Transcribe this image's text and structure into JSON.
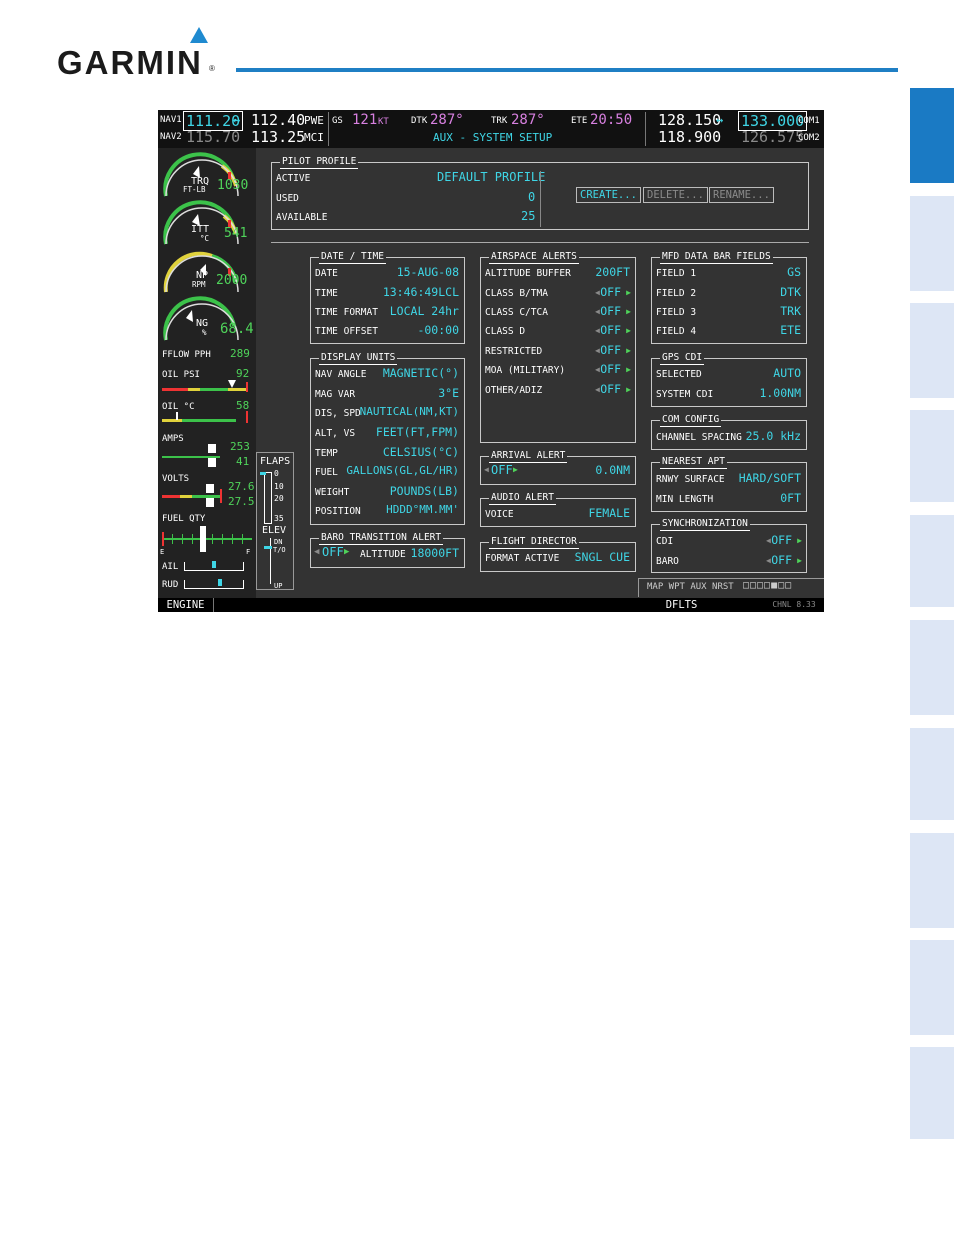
{
  "page": {
    "brand": "GARMIN",
    "registered": "®"
  },
  "header": {
    "nav1_label": "NAV1",
    "nav1_active": "111.20",
    "nav1_arrow": "↔",
    "nav1_standby": "112.40",
    "nav1_id": "PWE",
    "nav2_label": "NAV2",
    "nav2_active": "115.70",
    "nav2_standby": "113.25",
    "nav2_id": "MCI",
    "gs_label": "GS",
    "gs_value": "121",
    "gs_unit": "KT",
    "dtk_label": "DTK",
    "dtk_value": "287°",
    "trk_label": "TRK",
    "trk_value": "287°",
    "ete_label": "ETE",
    "ete_value": "20:50",
    "page_title": "AUX - SYSTEM SETUP",
    "com1_active": "128.150",
    "com1_arrow": "↔",
    "com1_standby": "133.000",
    "com1_label": "COM1",
    "com2_active": "118.900",
    "com2_standby": "126.575",
    "com2_label": "COM2"
  },
  "eis": {
    "trq_label": "TRQ",
    "trq_unit": "FT-LB",
    "trq_value": "1030",
    "itt_label": "ITT",
    "itt_unit": "°C",
    "itt_value": "541",
    "np_label": "NP",
    "np_unit": "RPM",
    "np_value": "2000",
    "ng_label": "NG",
    "ng_unit": "%",
    "ng_value": "68.4",
    "fflow_label": "FFLOW PPH",
    "fflow_value": "289",
    "oilpsi_label": "OIL PSI",
    "oilpsi_value": "92",
    "oilc_label": "OIL °C",
    "oilc_value": "58",
    "amps_label": "AMPS",
    "amps_value1": "253",
    "amps_value2": "41",
    "volts_label": "VOLTS",
    "volts_value1": "27.6",
    "volts_value2": "27.5",
    "fuelqty_label": "FUEL QTY",
    "fuel_e": "E",
    "fuel_f": "F",
    "ail_label": "AIL",
    "rud_label": "RUD",
    "flaps_label": "FLAPS",
    "flaps_ticks": [
      "0",
      "10",
      "20",
      "35"
    ],
    "elev_label": "ELEV",
    "elev_dn": "DN",
    "elev_to": "T/O",
    "elev_up": "UP"
  },
  "pilot_profile": {
    "title": "PILOT PROFILE",
    "active_label": "ACTIVE",
    "active_value": "DEFAULT PROFILE",
    "used_label": "USED",
    "used_value": "0",
    "available_label": "AVAILABLE",
    "available_value": "25",
    "create_btn": "CREATE...",
    "delete_btn": "DELETE...",
    "rename_btn": "RENAME..."
  },
  "date_time": {
    "title": "DATE / TIME",
    "rows": [
      {
        "label": "DATE",
        "value": "15-AUG-08"
      },
      {
        "label": "TIME",
        "value": "13:46:49LCL"
      },
      {
        "label": "TIME FORMAT",
        "value": "LOCAL 24hr"
      },
      {
        "label": "TIME OFFSET",
        "value": "-00:00"
      }
    ]
  },
  "display_units": {
    "title": "DISPLAY UNITS",
    "rows": [
      {
        "label": "NAV ANGLE",
        "value": "MAGNETIC(°)"
      },
      {
        "label": "MAG VAR",
        "value": "3°E"
      },
      {
        "label": "DIS, SPD",
        "value": "NAUTICAL(NM,KT)"
      },
      {
        "label": "ALT, VS",
        "value": "FEET(FT,FPM)"
      },
      {
        "label": "TEMP",
        "value": "CELSIUS(°C)"
      },
      {
        "label": "FUEL",
        "value": "GALLONS(GL,GL/HR)"
      },
      {
        "label": "WEIGHT",
        "value": "POUNDS(LB)"
      },
      {
        "label": "POSITION",
        "value": "HDDD°MM.MM'"
      }
    ]
  },
  "baro_transition": {
    "title": "BARO TRANSITION ALERT",
    "state": "OFF",
    "alt_label": "ALTITUDE",
    "alt_value": "18000FT"
  },
  "airspace_alerts": {
    "title": "AIRSPACE ALERTS",
    "rows": [
      {
        "label": "ALTITUDE BUFFER",
        "value": "200FT"
      },
      {
        "label": "CLASS B/TMA",
        "value": "OFF"
      },
      {
        "label": "CLASS C/TCA",
        "value": "OFF"
      },
      {
        "label": "CLASS D",
        "value": "OFF"
      },
      {
        "label": "RESTRICTED",
        "value": "OFF"
      },
      {
        "label": "MOA (MILITARY)",
        "value": "OFF"
      },
      {
        "label": "OTHER/ADIZ",
        "value": "OFF"
      }
    ]
  },
  "arrival_alert": {
    "title": "ARRIVAL ALERT",
    "state": "OFF",
    "value": "0.0NM"
  },
  "audio_alert": {
    "title": "AUDIO ALERT",
    "label": "VOICE",
    "value": "FEMALE"
  },
  "flight_director": {
    "title": "FLIGHT DIRECTOR",
    "label": "FORMAT ACTIVE",
    "value": "SNGL CUE"
  },
  "mfd_fields": {
    "title": "MFD DATA BAR FIELDS",
    "rows": [
      {
        "label": "FIELD 1",
        "value": "GS"
      },
      {
        "label": "FIELD 2",
        "value": "DTK"
      },
      {
        "label": "FIELD 3",
        "value": "TRK"
      },
      {
        "label": "FIELD 4",
        "value": "ETE"
      }
    ]
  },
  "gps_cdi": {
    "title": "GPS CDI",
    "selected_label": "SELECTED",
    "selected_value": "AUTO",
    "system_label": "SYSTEM CDI",
    "system_value": "1.00NM"
  },
  "com_config": {
    "title": "COM CONFIG",
    "label": "CHANNEL SPACING",
    "value": "25.0 kHz"
  },
  "nearest_apt": {
    "title": "NEAREST APT",
    "surface_label": "RNWY SURFACE",
    "surface_value": "HARD/SOFT",
    "length_label": "MIN LENGTH",
    "length_value": "0FT"
  },
  "synchronization": {
    "title": "SYNCHRONIZATION",
    "cdi_label": "CDI",
    "cdi_value": "OFF",
    "baro_label": "BARO",
    "baro_value": "OFF"
  },
  "page_group": {
    "text": "MAP WPT AUX NRST",
    "indicator": "□□□□■□□"
  },
  "softkeys": {
    "engine": "ENGINE",
    "dflts": "DFLTS",
    "channel": "CHNL 8.33"
  }
}
